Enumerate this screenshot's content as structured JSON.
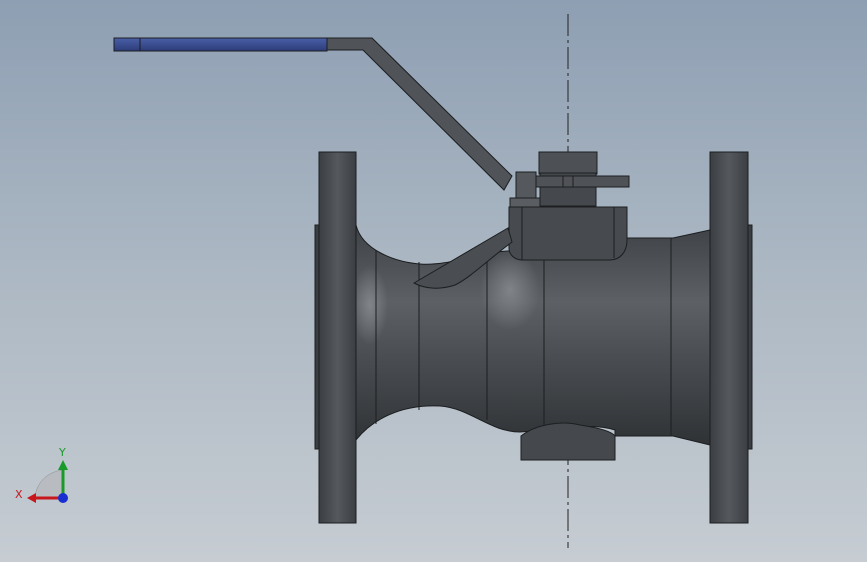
{
  "viewport": {
    "background_top": "#8e9fb3",
    "background_bottom": "#c6ccd2"
  },
  "model": {
    "handle_grip_color": "#34488c",
    "body_color": "#4b4f53"
  },
  "triad": {
    "x_label": "X",
    "y_label": "Y",
    "x_color": "#c8161d",
    "y_color": "#1a9a2a",
    "z_color": "#1a2fd0"
  }
}
